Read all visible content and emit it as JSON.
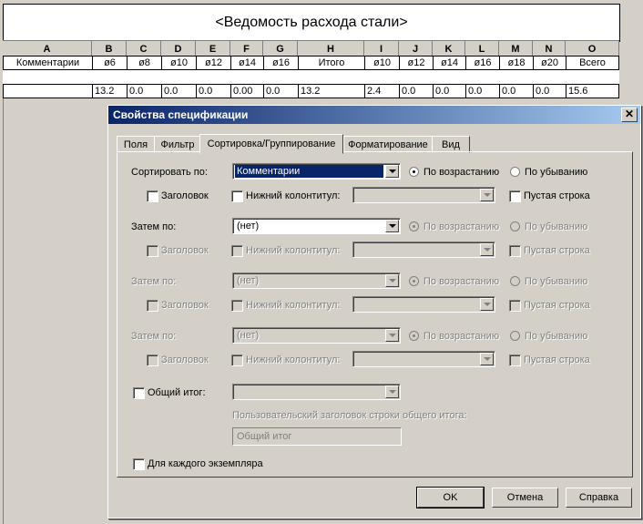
{
  "schedule": {
    "title": "<Ведомость расхода стали>",
    "columns": [
      "A",
      "B",
      "C",
      "D",
      "E",
      "F",
      "G",
      "H",
      "I",
      "J",
      "K",
      "L",
      "M",
      "N",
      "O"
    ],
    "subheaders": [
      "Комментарии",
      "ø6",
      "ø8",
      "ø10",
      "ø12",
      "ø14",
      "ø16",
      "Итого",
      "ø10",
      "ø12",
      "ø14",
      "ø16",
      "ø18",
      "ø20",
      "Всего"
    ],
    "values": [
      "",
      "13.2",
      "0.0",
      "0.0",
      "0.0",
      "0.00",
      "0.0",
      "13.2",
      "2.4",
      "0.0",
      "0.0",
      "0.0",
      "0.0",
      "0.0",
      "15.6"
    ]
  },
  "dialog": {
    "title": "Свойства спецификации",
    "close": "✕",
    "tabs": [
      "Поля",
      "Фильтр",
      "Сортировка/Группирование",
      "Форматирование",
      "Вид"
    ],
    "active_tab": "Сортировка/Группирование",
    "sort_label": "Сортировать по:",
    "then_label": "Затем по:",
    "asc": "По возрастанию",
    "desc": "По убыванию",
    "header": "Заголовок",
    "footer": "Нижний колонтитул:",
    "blank_line": "Пустая строка",
    "sort_value": "Комментарии",
    "then_value": "(нет)",
    "grand_total": "Общий итог:",
    "grand_total_caption": "Пользовательский заголовок строки общего итога:",
    "grand_total_value": "Общий итог",
    "each_instance": "Для каждого экземпляра",
    "buttons": {
      "ok": "OK",
      "cancel": "Отмена",
      "help": "Справка"
    }
  }
}
